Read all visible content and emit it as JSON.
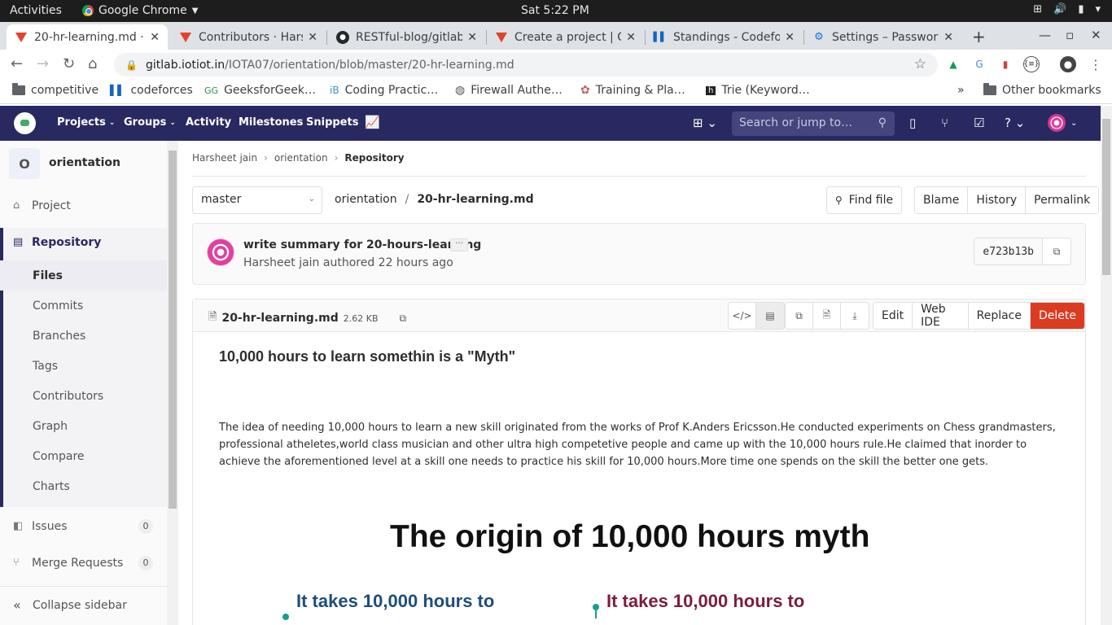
{
  "os": {
    "activities": "Activities",
    "app_name": "Google Chrome",
    "clock": "Sat  5:22 PM"
  },
  "tabs": [
    {
      "title": "20-hr-learning.md · ",
      "icon": "gitlab-icon"
    },
    {
      "title": "Contributors · Hars",
      "icon": "gitlab-icon"
    },
    {
      "title": "RESTful-blog/gitlab",
      "icon": "github-icon"
    },
    {
      "title": "Create a project | Gi",
      "icon": "gitlab-icon"
    },
    {
      "title": "Standings - Codefo",
      "icon": "codeforces-icon"
    },
    {
      "title": "Settings – Passwor",
      "icon": "gear-icon"
    }
  ],
  "address": {
    "host": "gitlab.iotiot.in",
    "path": "/IOTA07/orientation/blob/master/20-hr-learning.md"
  },
  "bookmarks": [
    {
      "label": "competitive",
      "icon": "folder-icon"
    },
    {
      "label": "codeforces",
      "icon": "codeforces-icon"
    },
    {
      "label": "GeeksforGeek…",
      "icon": "geeksforgeeks-icon"
    },
    {
      "label": "Coding Practic…",
      "icon": "interviewbit-icon"
    },
    {
      "label": "Firewall Authe…",
      "icon": "globe-icon"
    },
    {
      "label": "Training & Pla…",
      "icon": "college-logo-icon"
    },
    {
      "label": "Trie (Keyword…",
      "icon": "hackerrank-icon"
    }
  ],
  "bookmarks_overflow": "»",
  "other_bookmarks": "Other bookmarks",
  "gitlab_nav": {
    "projects": "Projects",
    "groups": "Groups",
    "activity": "Activity",
    "milestones": "Milestones",
    "snippets": "Snippets",
    "search_placeholder": "Search or jump to…"
  },
  "sidebar": {
    "project_initial": "O",
    "project_name": "orientation",
    "project": "Project",
    "repository": "Repository",
    "sub_items": [
      "Files",
      "Commits",
      "Branches",
      "Tags",
      "Contributors",
      "Graph",
      "Compare",
      "Charts"
    ],
    "issues": "Issues",
    "issues_count": "0",
    "merge_requests": "Merge Requests",
    "merge_requests_count": "0",
    "collapse": "Collapse sidebar"
  },
  "breadcrumb": {
    "owner": "Harsheet jain",
    "project": "orientation",
    "current": "Repository",
    "separator": "›"
  },
  "file_nav": {
    "branch": "master",
    "root": "orientation",
    "slash": "/",
    "file": "20-hr-learning.md",
    "find_file": "Find file",
    "blame": "Blame",
    "history": "History",
    "permalink": "Permalink"
  },
  "commit": {
    "title": "write summary for 20-hours-learning",
    "more": "···",
    "meta": "Harsheet jain authored 22 hours ago",
    "sha": "e723b13b"
  },
  "file_header": {
    "name": "20-hr-learning.md",
    "size": "2.62 KB",
    "edit": "Edit",
    "web_ide": "Web IDE",
    "replace": "Replace",
    "delete": "Delete"
  },
  "markdown": {
    "heading": "10,000 hours to learn somethin is a \"Myth\"",
    "paragraph": "The idea of needing 10,000 hours to learn a new skill originated from the works of Prof K.Anders Ericsson.He conducted experiments on Chess grandmasters, professional atheletes,world class musician and other ultra high competetive people and came up with the 10,000 hours rule.He claimed that inorder to achieve the aforementioned level at a skill one needs to practice his skill for 10,000 hours.More time one spends on the skill the better one gets.",
    "image_title": "The origin of 10,000 hours myth",
    "image_left": "It takes 10,000 hours to",
    "image_right": "It takes 10,000 hours to"
  },
  "colors": {
    "gitlab_header": "#292961",
    "delete": "#db3b21",
    "image_left_text": "#1f4e79",
    "image_right_text": "#7b1e3a"
  }
}
